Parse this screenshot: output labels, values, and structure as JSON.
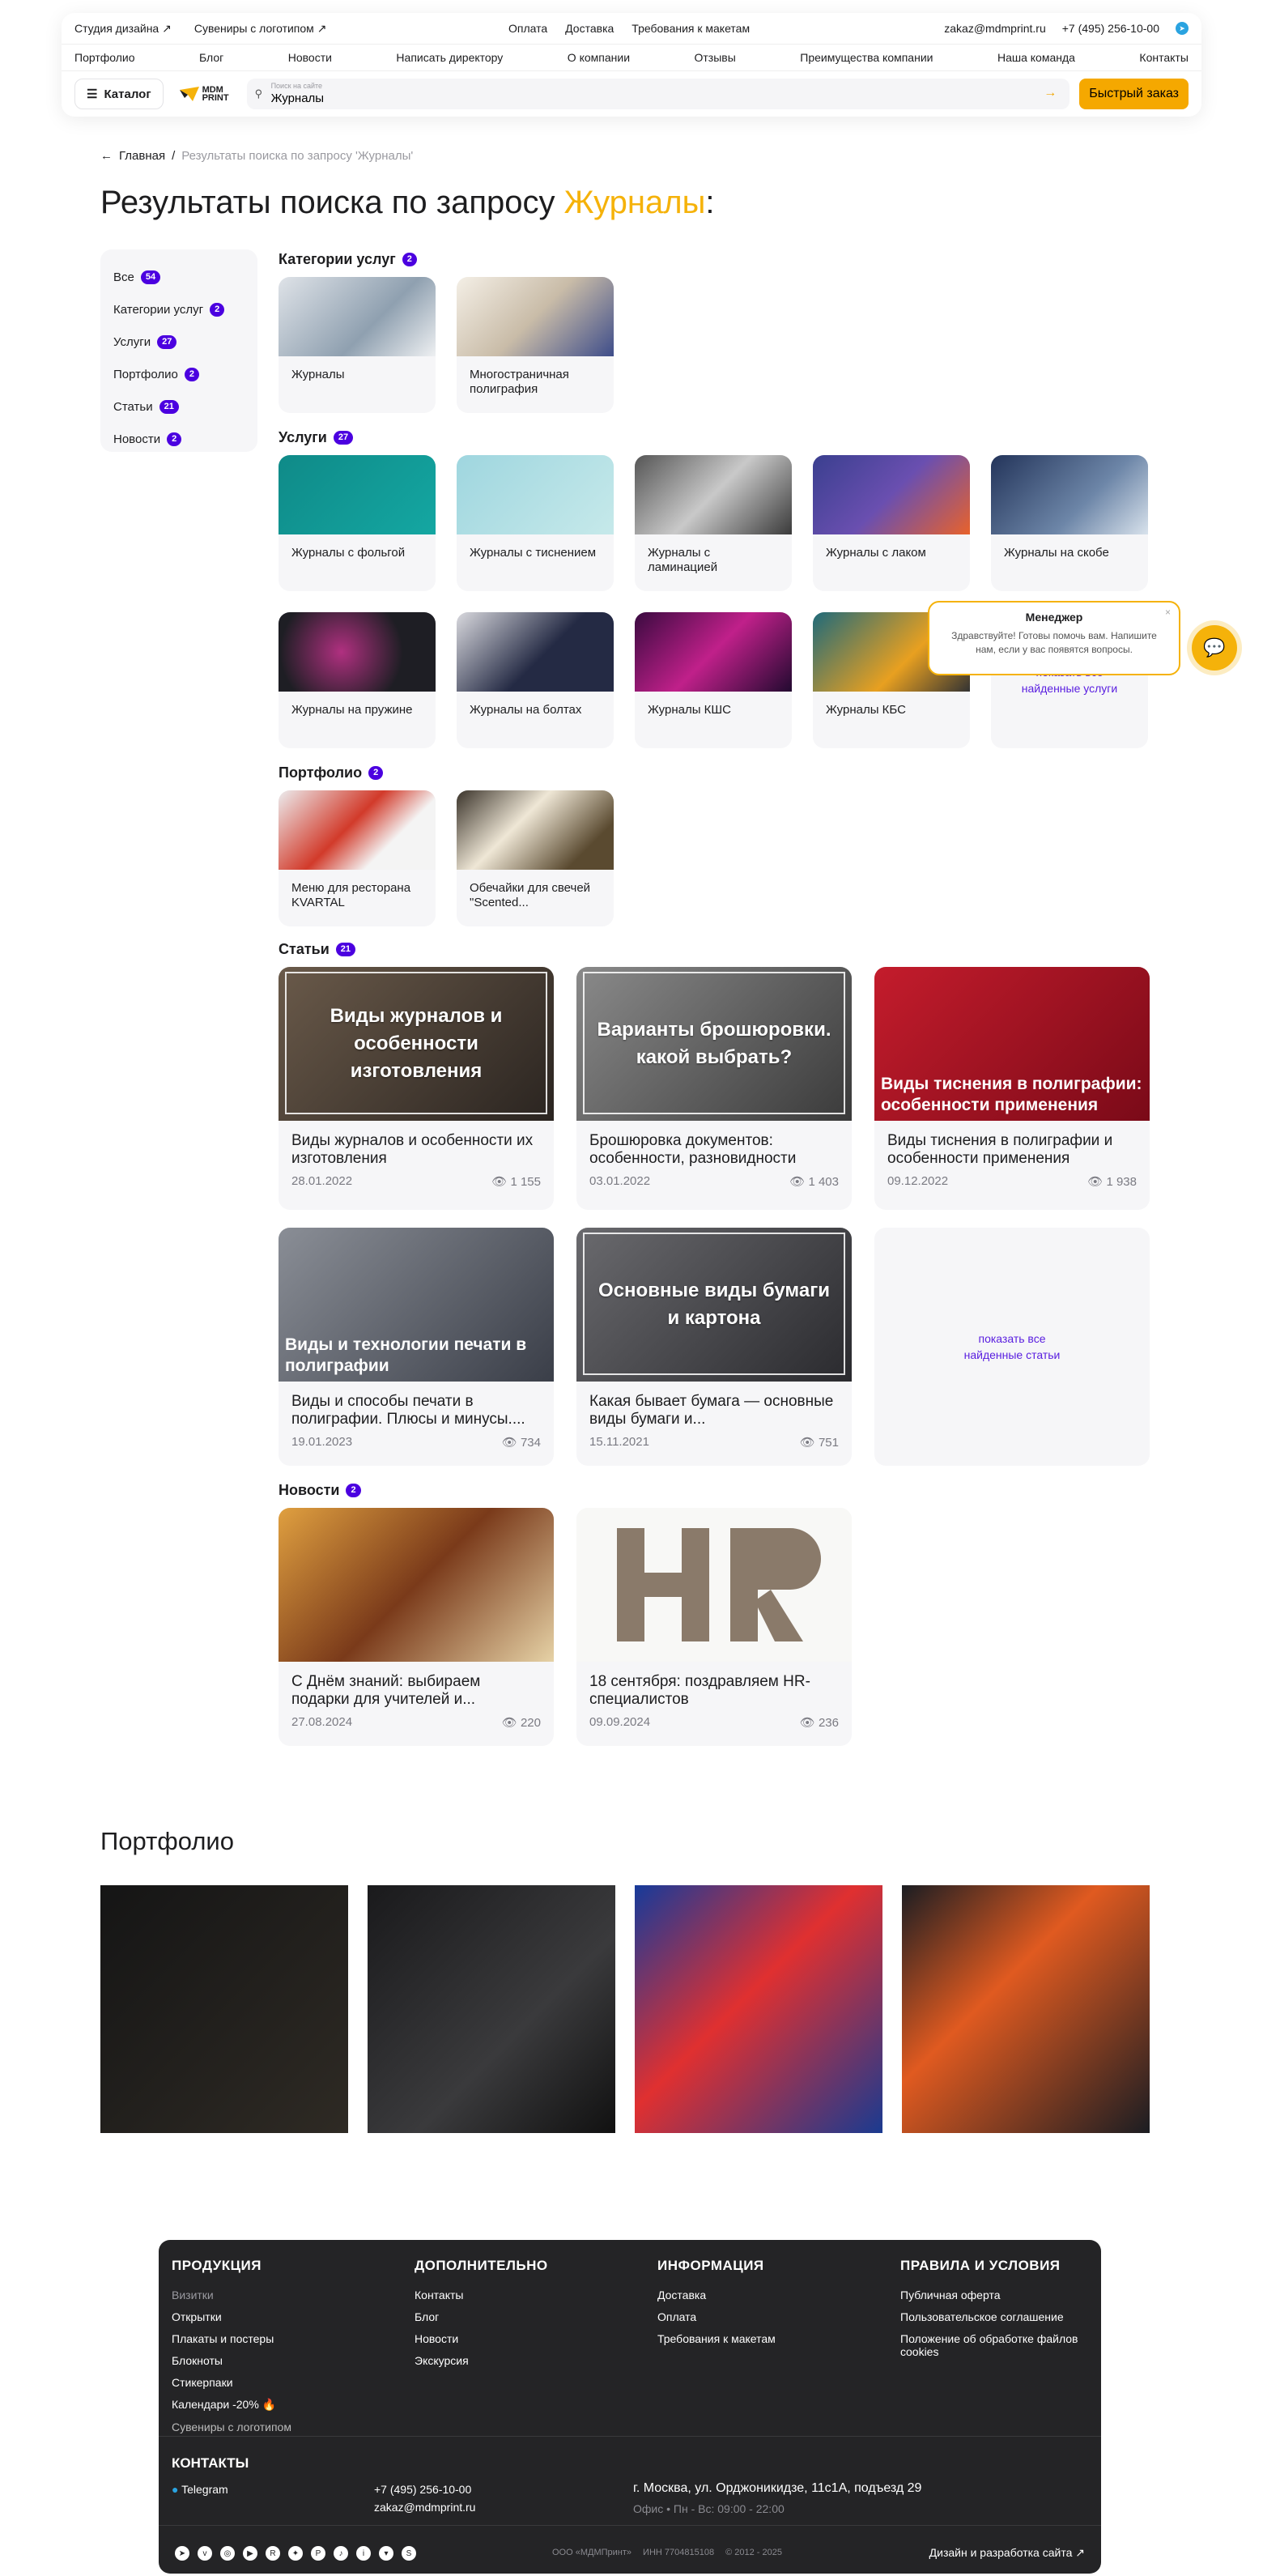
{
  "header": {
    "top_left": [
      "Студия дизайна ↗",
      "Сувениры с логотипом ↗"
    ],
    "top_mid": [
      "Оплата",
      "Доставка",
      "Требования к макетам"
    ],
    "email": "zakaz@mdmprint.ru",
    "phone": "+7 (495) 256-10-00",
    "nav": [
      "Портфолио",
      "Блог",
      "Новости",
      "Написать директору",
      "О компании",
      "Отзывы",
      "Преимущества компании",
      "Наша команда",
      "Контакты"
    ],
    "catalog": "Каталог",
    "logo_line1": "MDM",
    "logo_line2": "PRINT",
    "search_placeholder": "Поиск на сайте",
    "search_value": "Журналы",
    "quick_order": "Быстрый заказ"
  },
  "breadcrumb": {
    "home": "Главная",
    "sep": "/",
    "current": "Результаты поиска по запросу 'Журналы'"
  },
  "title": {
    "prefix": "Результаты поиска по запросу ",
    "query": "Журналы",
    "suffix": ":"
  },
  "filters": [
    {
      "label": "Все",
      "count": "54"
    },
    {
      "label": "Категории услуг",
      "count": "2"
    },
    {
      "label": "Услуги",
      "count": "27"
    },
    {
      "label": "Портфолио",
      "count": "2"
    },
    {
      "label": "Статьи",
      "count": "21"
    },
    {
      "label": "Новости",
      "count": "2"
    }
  ],
  "sections": {
    "categories": {
      "label": "Категории услуг",
      "count": "2"
    },
    "services": {
      "label": "Услуги",
      "count": "27"
    },
    "portfolio": {
      "label": "Портфолио",
      "count": "2"
    },
    "articles": {
      "label": "Статьи",
      "count": "21"
    },
    "news": {
      "label": "Новости",
      "count": "2"
    }
  },
  "categories": [
    "Журналы",
    "Многостраничная полиграфия"
  ],
  "services": [
    "Журналы с фольгой",
    "Журналы с тиснением",
    "Журналы с ламинацией",
    "Журналы с лаком",
    "Журналы на скобе",
    "Журналы на пружине",
    "Журналы на болтах",
    "Журналы КШС",
    "Журналы КБС"
  ],
  "services_more": "показать все найденные услуги",
  "portfolio_items": [
    "Меню для ресторана KVARTAL",
    "Обечайки для свечей \"Scented..."
  ],
  "articles": [
    {
      "img_text": "Виды журналов и особенности изготовления",
      "title": "Виды журналов и особенности их изготовления",
      "date": "28.01.2022",
      "views": "1 155"
    },
    {
      "img_text": "Варианты брошюровки. какой выбрать?",
      "title": "Брошюровка документов: особенности, разновидности",
      "date": "03.01.2022",
      "views": "1 403"
    },
    {
      "img_text": "Виды тиснения в полиграфии: особенности применения",
      "title": "Виды тиснения в полиграфии и особенности применения",
      "date": "09.12.2022",
      "views": "1 938"
    },
    {
      "img_text": "Виды и технологии печати в полиграфии",
      "title": "Виды и способы печати в полиграфии. Плюсы и минусы....",
      "date": "19.01.2023",
      "views": "734"
    },
    {
      "img_text": "Основные виды бумаги и картона",
      "title": "Какая бывает бумага — основные виды бумаги и...",
      "date": "15.11.2021",
      "views": "751"
    }
  ],
  "articles_more": "показать все найденные статьи",
  "news": [
    {
      "title": "С Днём знаний: выбираем подарки для учителей и...",
      "date": "27.08.2024",
      "views": "220"
    },
    {
      "title": "18 сентября: поздравляем HR-специалистов",
      "date": "09.09.2024",
      "views": "236"
    }
  ],
  "portfolio_heading": "Портфолио",
  "chat": {
    "title": "Менеджер",
    "text": "Здравствуйте! Готовы помочь вам. Напишите нам, если у вас появятся вопросы."
  },
  "footer": {
    "cols": [
      {
        "h": "ПРОДУКЦИЯ",
        "items": [
          "Визитки",
          "Открытки",
          "Плакаты и постеры",
          "Блокноты",
          "Стикерпаки",
          "Календари -20% 🔥",
          "Сувениры с логотипом"
        ]
      },
      {
        "h": "ДОПОЛНИТЕЛЬНО",
        "items": [
          "Контакты",
          "Блог",
          "Новости",
          "Экскурсия"
        ]
      },
      {
        "h": "ИНФОРМАЦИЯ",
        "items": [
          "Доставка",
          "Оплата",
          "Требования к макетам"
        ]
      },
      {
        "h": "ПРАВИЛА И УСЛОВИЯ",
        "items": [
          "Публичная оферта",
          "Пользовательское соглашение",
          "Положение об обработке файлов cookies"
        ]
      }
    ],
    "contacts": "КОНТАКТЫ",
    "telegram": "Telegram",
    "phone": "+7 (495) 256-10-00",
    "email": "zakaz@mdmprint.ru",
    "address": "г. Москва, ул. Орджоникидзе, 11с1А, подъезд 29",
    "hours": "Офис • Пн - Вс: 09:00 - 22:00",
    "company": "ООО «МДМПринт»",
    "inn": "ИНН 7704815108",
    "years": "© 2012 - 2025",
    "dev": "Дизайн и разработка сайта ↗"
  }
}
